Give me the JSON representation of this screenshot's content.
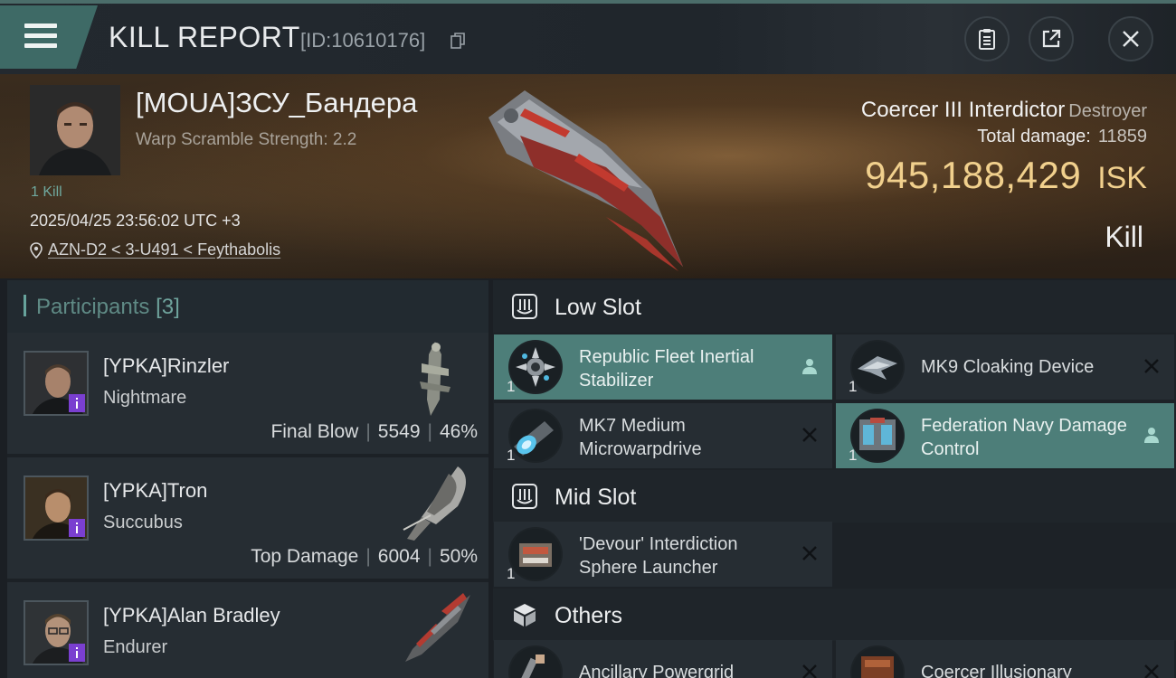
{
  "header": {
    "title": "KILL REPORT",
    "report_id": "[ID:10610176]"
  },
  "victim": {
    "pilot_name": "[MOUA]ЗСУ_Бандера",
    "warp_scramble": "Warp Scramble Strength: 2.2",
    "kills": "1 Kill",
    "datetime": "2025/04/25 23:56:02 UTC +3",
    "location": "AZN-D2 < 3-U491 < Feythabolis",
    "ship_name": "Coercer III Interdictor",
    "ship_class": "Destroyer",
    "total_damage_label": "Total damage:",
    "total_damage": "11859",
    "isk_value": "945,188,429",
    "isk_unit": "ISK",
    "result": "Kill"
  },
  "participants": {
    "title": "Participants",
    "count": "[3]",
    "items": [
      {
        "name": "[YPKA]Rinzler",
        "ship": "Nightmare",
        "role": "Final Blow",
        "damage": "5549",
        "percent": "46%"
      },
      {
        "name": "[YPKA]Tron",
        "ship": "Succubus",
        "role": "Top Damage",
        "damage": "6004",
        "percent": "50%"
      },
      {
        "name": "[YPKA]Alan Bradley",
        "ship": "Endurer",
        "role": "",
        "damage": "",
        "percent": ""
      }
    ]
  },
  "fitting": {
    "low_slot": "Low Slot",
    "mid_slot": "Mid Slot",
    "others": "Others",
    "modules": {
      "m1": {
        "name": "Republic Fleet Inertial Stabilizer",
        "qty": "1",
        "state": "dropped"
      },
      "m2": {
        "name": "MK9 Cloaking Device",
        "qty": "1",
        "state": "destroyed"
      },
      "m3": {
        "name": "MK7 Medium Microwarpdrive",
        "qty": "1",
        "state": "destroyed"
      },
      "m4": {
        "name": "Federation Navy Damage Control",
        "qty": "1",
        "state": "dropped"
      },
      "m5": {
        "name": "'Devour' Interdiction Sphere Launcher",
        "qty": "1",
        "state": "destroyed"
      },
      "m6": {
        "name": "Ancillary Powergrid",
        "qty": "",
        "state": "destroyed"
      },
      "m7": {
        "name": "Coercer Illusionary",
        "qty": "",
        "state": "destroyed"
      }
    }
  },
  "colors": {
    "accent": "#4d7e79",
    "isk_gold": "#f1d08d",
    "background": "#1b1f24"
  }
}
